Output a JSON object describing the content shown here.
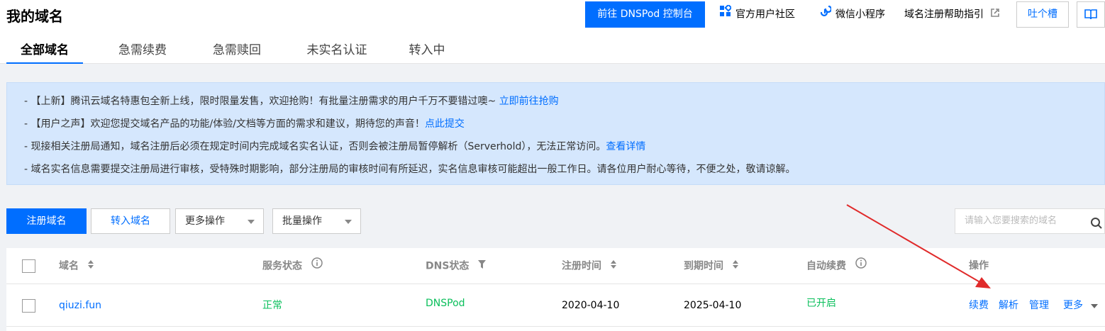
{
  "header": {
    "title": "我的域名",
    "tabs": [
      "全部域名",
      "急需续费",
      "急需赎回",
      "未实名认证",
      "转入中"
    ],
    "active_tab": "全部域名",
    "actions": {
      "dnspod_console": "前往 DNSPod 控制台",
      "community": "官方用户社区",
      "mini_program": "微信小程序",
      "help_guide": "域名注册帮助指引",
      "feedback": "吐个槽"
    }
  },
  "notice": {
    "lines": [
      {
        "text": "- 【上新】腾讯云域名特惠包全新上线，限时限量发售，欢迎抢购！有批量注册需求的用户千万不要错过噢~ ",
        "link": "立即前往抢购"
      },
      {
        "text": "- 【用户之声】欢迎您提交域名产品的功能/体验/文档等方面的需求和建议，期待您的声音！",
        "link": "点此提交"
      },
      {
        "text": "- 现接相关注册局通知，域名注册后必须在规定时间内完成域名实名认证，否则会被注册局暂停解析（Serverhold），无法正常访问。",
        "link": "查看详情"
      },
      {
        "text": "- 域名实名信息需要提交注册局进行审核，受特殊时期影响，部分注册局的审核时间有所延迟，实名信息审核可能超出一般工作日。请各位用户耐心等待，不便之处，敬请谅解。",
        "link": ""
      }
    ]
  },
  "toolbar": {
    "register": "注册域名",
    "transfer_in": "转入域名",
    "more_ops": "更多操作",
    "batch_ops": "批量操作",
    "search_placeholder": "请输入您要搜索的域名"
  },
  "table": {
    "columns": {
      "domain": "域名",
      "service_status": "服务状态",
      "dns_status": "DNS状态",
      "reg_time": "注册时间",
      "expire_time": "到期时间",
      "auto_renew": "自动续费",
      "ops": "操作"
    },
    "rows": [
      {
        "domain": "qiuzi.fun",
        "service_status": "正常",
        "dns_status": "DNSPod",
        "reg_time": "2020-04-10",
        "expire_time": "2025-04-10",
        "auto_renew": "已开启",
        "ops": [
          "续费",
          "解析",
          "管理",
          "更多"
        ]
      }
    ]
  },
  "colors": {
    "primary": "#006eff",
    "success": "#0abf5b",
    "annotation_arrow": "#e02a2a"
  }
}
